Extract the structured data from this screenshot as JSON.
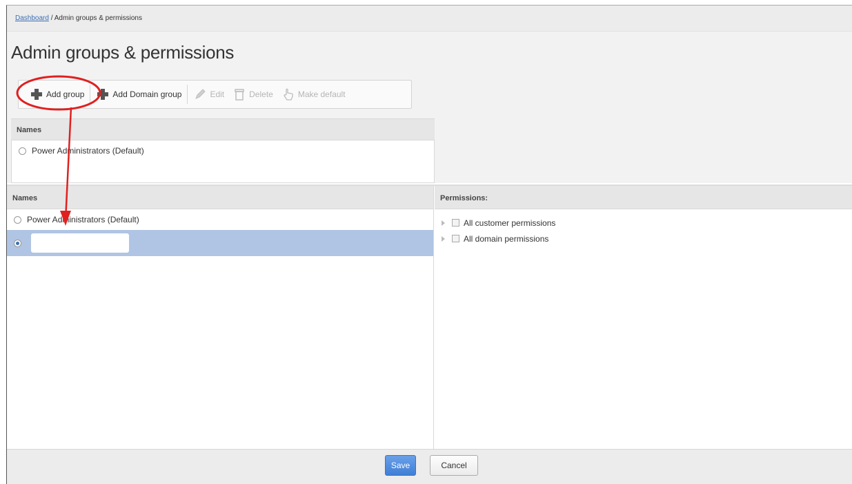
{
  "breadcrumb": {
    "link": "Dashboard",
    "separator": " / ",
    "current": "Admin groups & permissions"
  },
  "page": {
    "title": "Admin groups & permissions"
  },
  "toolbar": {
    "add_group": "Add group",
    "add_domain_group": "Add Domain group",
    "edit": "Edit",
    "delete": "Delete",
    "make_default": "Make default"
  },
  "names_panel_1": {
    "header": "Names",
    "items": [
      {
        "label": "Power Administrators (Default)",
        "selected": false
      }
    ]
  },
  "names_panel_2": {
    "header": "Names",
    "items": [
      {
        "label": "Power Administrators (Default)",
        "selected": false
      }
    ],
    "new_group_input": {
      "value": "",
      "selected": true
    }
  },
  "permissions": {
    "header": "Permissions:",
    "items": [
      {
        "label": "All customer permissions",
        "checked": false
      },
      {
        "label": "All domain permissions",
        "checked": false
      }
    ]
  },
  "footer": {
    "save_label": "Save",
    "cancel_label": "Cancel"
  },
  "colors": {
    "annotation": "#e02020",
    "selection": "#b0c4e4",
    "primary_button": "#4a88dc"
  }
}
